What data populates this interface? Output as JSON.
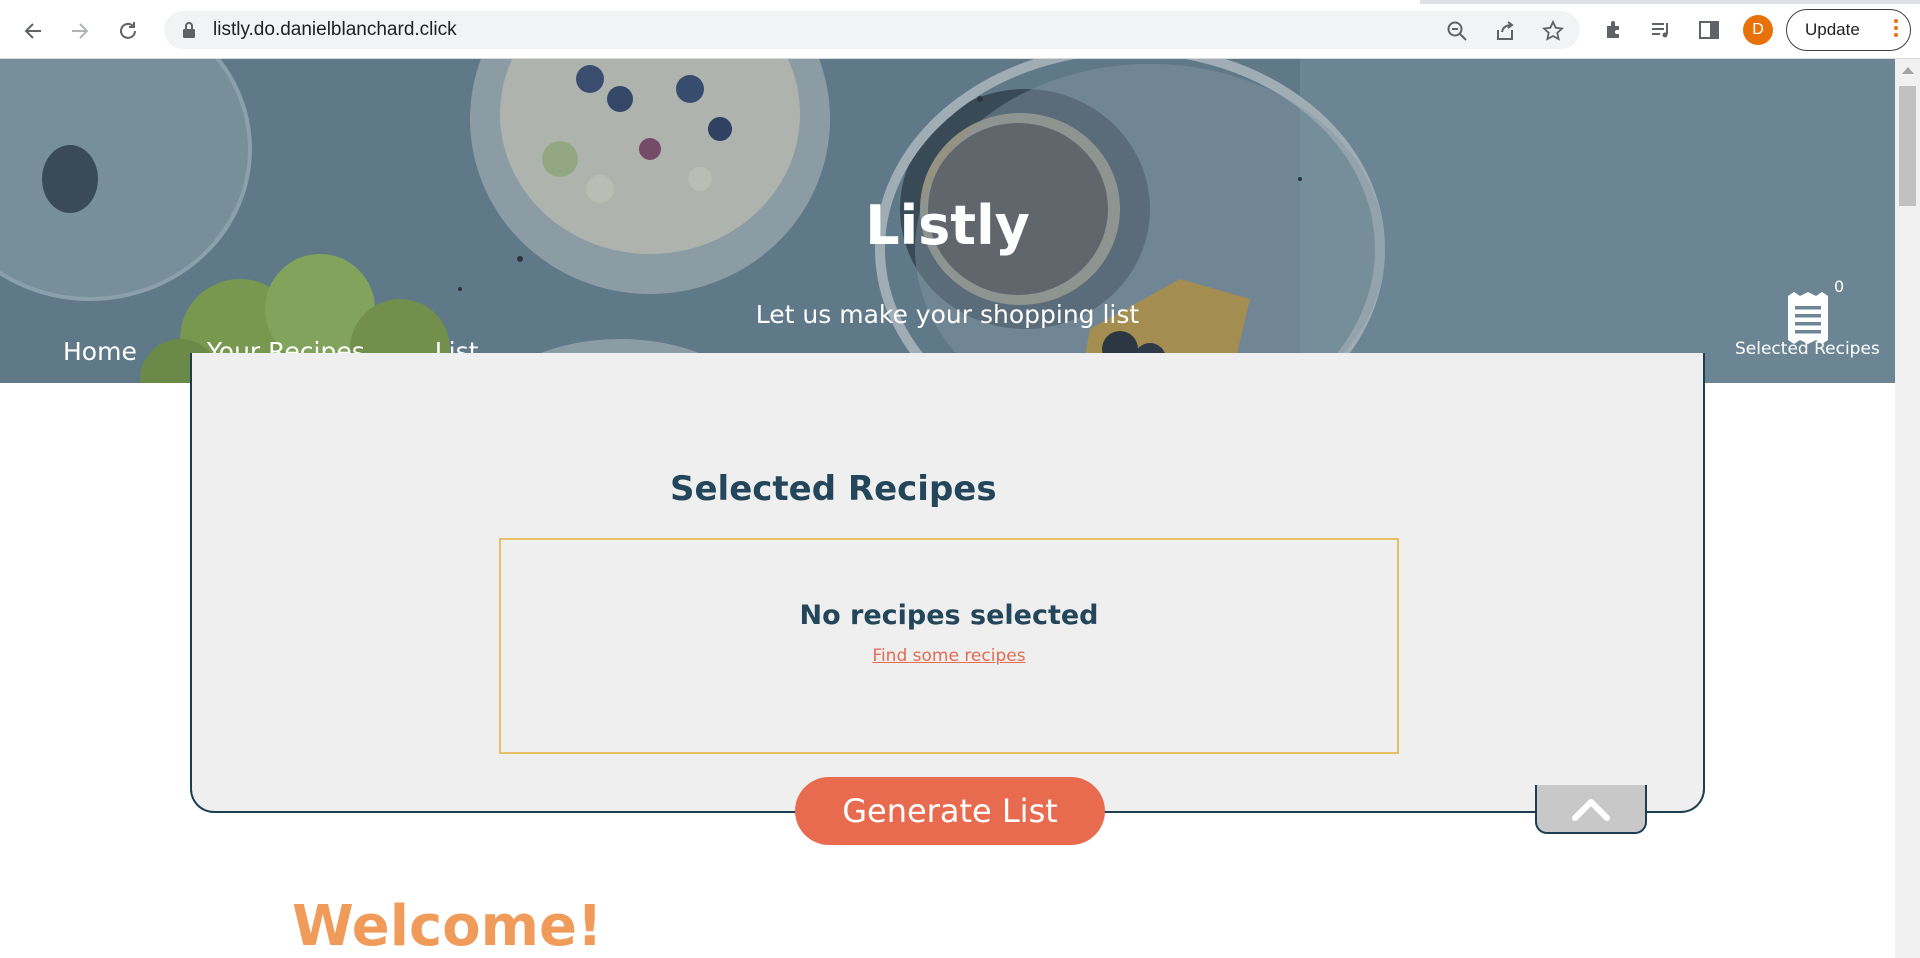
{
  "browser": {
    "url": "listly.do.danielblanchard.click",
    "profile_initial": "D",
    "update_label": "Update",
    "accent": "#e8710a"
  },
  "site": {
    "title": "Listly",
    "tagline": "Let us make your shopping list",
    "nav": [
      "Home",
      "Your Recipes",
      "List"
    ],
    "selected_count": "0",
    "selected_label": "Selected Recipes"
  },
  "panel": {
    "title": "Selected Recipes",
    "empty_title": "No recipes selected",
    "empty_link": "Find some recipes",
    "generate_label": "Generate List"
  },
  "welcome": "Welcome!",
  "colors": {
    "navy": "#24465a",
    "coral": "#e86b50",
    "gold_border": "#e6c065",
    "orange_heading": "#f19b5a"
  }
}
